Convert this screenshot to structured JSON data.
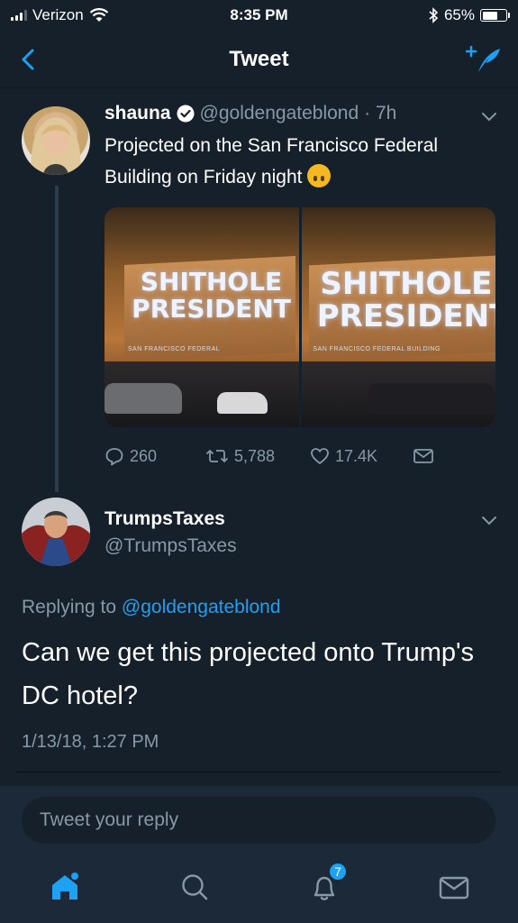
{
  "status_bar": {
    "carrier": "Verizon",
    "time": "8:35 PM",
    "battery_percent": "65%",
    "battery_level": 0.65
  },
  "nav": {
    "title": "Tweet"
  },
  "tweet": {
    "name": "shauna",
    "handle": "@goldengateblond",
    "age": "· 7h",
    "text": "Projected on the San Francisco Federal Building on Friday night",
    "media": {
      "left_text_line1": "SHITHOLE",
      "left_text_line2": "PRESIDENT",
      "left_caption": "SAN FRANCISCO FEDERAL",
      "right_text_line1": "SHITHOLE",
      "right_text_line2": "PRESIDENT",
      "right_caption": "SAN FRANCISCO FEDERAL BUILDING"
    },
    "actions": {
      "replies": "260",
      "retweets": "5,788",
      "likes": "17.4K"
    }
  },
  "reply": {
    "name": "TrumpsTaxes",
    "handle": "@TrumpsTaxes",
    "replying_prefix": "Replying to ",
    "replying_to": "@goldengateblond",
    "text": "Can we get this projected onto Trump's DC hotel?",
    "timestamp": "1/13/18, 1:27 PM"
  },
  "compose": {
    "placeholder": "Tweet your reply"
  },
  "tabs": {
    "notifications_badge": "7"
  },
  "colors": {
    "background": "#15202b",
    "accent": "#1da1f2",
    "muted_text": "#8899a6"
  }
}
